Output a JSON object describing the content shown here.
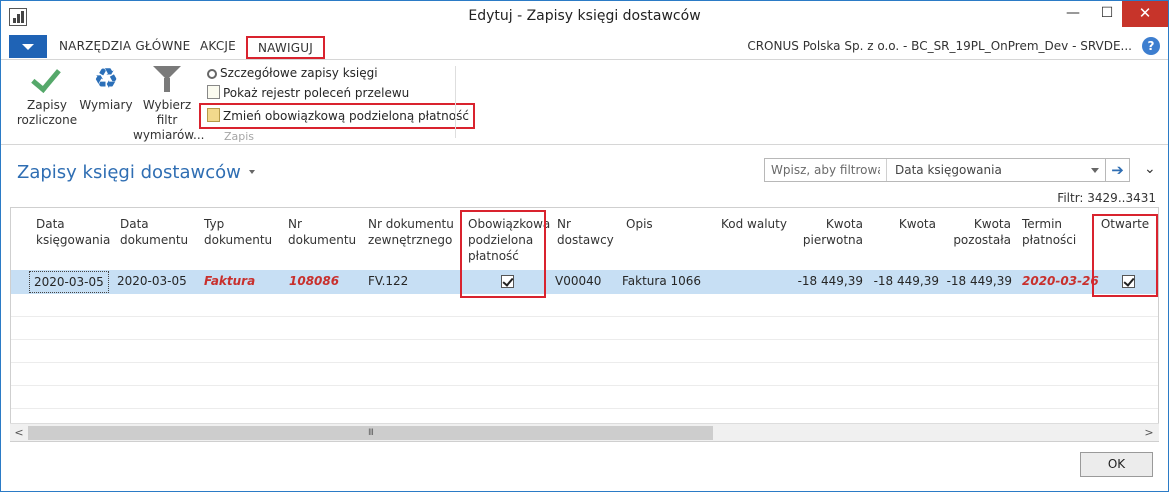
{
  "window": {
    "title": "Edytuj - Zapisy księgi dostawców",
    "minimize_glyph": "—",
    "maximize_glyph": "☐",
    "close_glyph": "✕"
  },
  "ribbon_tabs": {
    "tabs": [
      "NARZĘDZIA GŁÓWNE",
      "AKCJE",
      "NAWIGUJ"
    ],
    "active_tab": "NAWIGUJ",
    "company": "CRONUS Polska Sp. z o.o. - BC_SR_19PL_OnPrem_Dev - SRVDE...",
    "help_glyph": "?"
  },
  "ribbon": {
    "buttons": [
      {
        "label": "Zapisy rozliczone",
        "icon": "check-icon"
      },
      {
        "label": "Wymiary",
        "icon": "dimensions-icon"
      },
      {
        "label": "Wybierz filtr wymiarów...",
        "icon": "filter-icon"
      }
    ],
    "small_buttons": [
      {
        "label": "Szczegółowe zapisy księgi",
        "icon": "magnifier-icon"
      },
      {
        "label": "Pokaż rejestr poleceń przelewu",
        "icon": "document-icon"
      },
      {
        "label": "Zmień obowiązkową podzieloną płatność",
        "icon": "clipboard-icon"
      }
    ],
    "group_label": "Zapis"
  },
  "page": {
    "title": "Zapisy księgi dostawców",
    "search_placeholder": "Wpisz, aby filtrowa...",
    "filter_field": "Data księgowania",
    "go_glyph": "➔",
    "collapse_glyph": "⌄",
    "filter_text": "Filtr: 3429..3431"
  },
  "grid": {
    "columns": [
      "Data księgowania",
      "Data dokumentu",
      "Typ dokumentu",
      "Nr dokumentu",
      "Nr dokumentu zewnętrznego",
      "Obowiązkowa podzielona płatność",
      "Nr dostawcy",
      "Opis",
      "Kod waluty",
      "Kwota pierwotna",
      "Kwota",
      "Kwota pozostała",
      "Termin płatności",
      "Otwarte"
    ],
    "rows": [
      {
        "posting_date": "2020-03-05",
        "document_date": "2020-03-05",
        "document_type": "Faktura",
        "document_no": "108086",
        "external_document_no": "FV.122",
        "split_payment": true,
        "vendor_no": "V00040",
        "description": "Faktura 1066",
        "currency_code": "",
        "original_amount": "-18 449,39",
        "amount": "-18 449,39",
        "remaining_amount": "-18 449,39",
        "due_date": "2020-03-26",
        "open": true
      }
    ]
  },
  "scrollbar": {
    "left_glyph": "<",
    "right_glyph": ">",
    "grip": "III"
  },
  "ok_label": "OK",
  "colors": {
    "highlight_border": "#d9232e",
    "accent_blue": "#2f6eb3",
    "selected_row": "#c7dff4",
    "red_text": "#c8302d"
  }
}
